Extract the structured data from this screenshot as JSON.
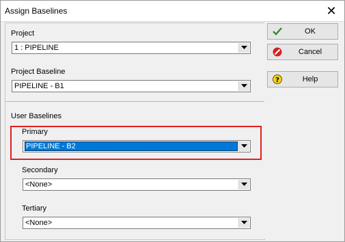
{
  "window": {
    "title": "Assign Baselines"
  },
  "project": {
    "label": "Project",
    "value": "1 : PIPELINE"
  },
  "project_baseline": {
    "label": "Project Baseline",
    "value": "PIPELINE - B1"
  },
  "user_baselines": {
    "label": "User Baselines",
    "primary": {
      "label": "Primary",
      "value": "PIPELINE - B2"
    },
    "secondary": {
      "label": "Secondary",
      "value": "<None>"
    },
    "tertiary": {
      "label": "Tertiary",
      "value": "<None>"
    }
  },
  "buttons": {
    "ok": "OK",
    "cancel": "Cancel",
    "help": "Help"
  },
  "colors": {
    "highlight": "#e02020",
    "selection": "#0078d7",
    "ok_check": "#2e8b2e",
    "cancel_red": "#d42020",
    "help_yellow": "#f2d21a"
  },
  "icons": [
    "close-icon",
    "check-icon",
    "cancel-icon",
    "help-icon",
    "dropdown-arrow-icon"
  ]
}
